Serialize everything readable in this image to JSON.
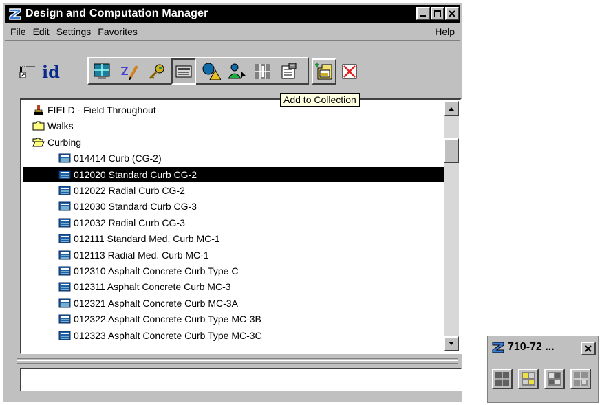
{
  "window": {
    "title": "Design and Computation Manager",
    "controls": [
      "minimize-icon",
      "maximize-icon",
      "close-icon"
    ]
  },
  "menu": {
    "items": [
      "File",
      "Edit",
      "Settings",
      "Favorites"
    ],
    "help": "Help"
  },
  "toolbar": {
    "id_label": "id",
    "tooltip": "Add to Collection"
  },
  "list": {
    "items": [
      {
        "label": "FIELD - Field Throughout",
        "icon": "paint-brush-icon",
        "indent": 1,
        "selected": false
      },
      {
        "label": "Walks",
        "icon": "folder-closed-icon",
        "indent": 1,
        "selected": false
      },
      {
        "label": "Curbing",
        "icon": "folder-open-icon",
        "indent": 1,
        "selected": false
      },
      {
        "label": "014414 Curb (CG-2)",
        "icon": "item-icon",
        "indent": 2,
        "selected": false
      },
      {
        "label": "012020 Standard Curb CG-2",
        "icon": "item-icon",
        "indent": 2,
        "selected": true
      },
      {
        "label": "012022 Radial Curb CG-2",
        "icon": "item-icon",
        "indent": 2,
        "selected": false
      },
      {
        "label": "012030 Standard Curb CG-3",
        "icon": "item-icon",
        "indent": 2,
        "selected": false
      },
      {
        "label": "012032 Radial Curb CG-3",
        "icon": "item-icon",
        "indent": 2,
        "selected": false
      },
      {
        "label": "012111 Standard Med. Curb MC-1",
        "icon": "item-icon",
        "indent": 2,
        "selected": false
      },
      {
        "label": "012113 Radial Med. Curb MC-1",
        "icon": "item-icon",
        "indent": 2,
        "selected": false
      },
      {
        "label": "012310 Asphalt Concrete Curb Type C",
        "icon": "item-icon",
        "indent": 2,
        "selected": false
      },
      {
        "label": "012311 Asphalt Concrete Curb MC-3",
        "icon": "item-icon",
        "indent": 2,
        "selected": false
      },
      {
        "label": "012321 Asphalt Concrete Curb MC-3A",
        "icon": "item-icon",
        "indent": 2,
        "selected": false
      },
      {
        "label": "012322 Asphalt Concrete Curb Type MC-3B",
        "icon": "item-icon",
        "indent": 2,
        "selected": false
      },
      {
        "label": "012323 Asphalt Concrete Curb Type MC-3C",
        "icon": "item-icon",
        "indent": 2,
        "selected": false
      }
    ]
  },
  "status": {
    "text": ""
  },
  "palette": {
    "title": "710-72 ...",
    "buttons": [
      "view-single-icon",
      "view-quad-yellow-icon",
      "view-quad-icon",
      "view-quad-gray-icon"
    ]
  },
  "colors": {
    "selection": "#000000",
    "tooltip_bg": "#ffffe1",
    "chrome": "#c0c0c0",
    "item_icon": "#1e5fa8"
  }
}
